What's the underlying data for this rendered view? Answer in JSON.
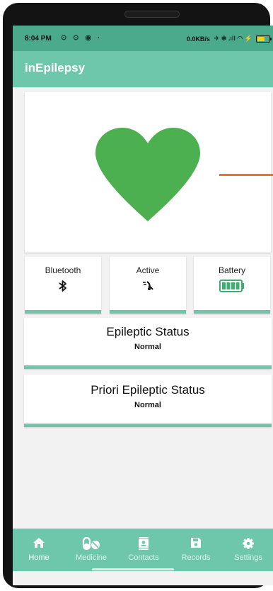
{
  "status_bar": {
    "time": "8:04 PM",
    "left_icons": "⊙ ⊙ ◉ ·",
    "net_speed": "0.0KB/s",
    "signal_icons": "✈ ✱ .ıll ◠ ⚡",
    "battery_level_fraction": 0.6,
    "battery_color": "#f2d21a"
  },
  "app_bar": {
    "title": "inEpilepsy",
    "color": "#6fc7ab"
  },
  "heart": {
    "icon": "heart-icon",
    "color": "#4caf50"
  },
  "sensors": [
    {
      "label": "Bluetooth",
      "icon": "bluetooth-icon",
      "glyph": "✱"
    },
    {
      "label": "Active",
      "icon": "sensor-activity-icon",
      "glyph": "≈"
    },
    {
      "label": "Battery",
      "icon": "battery-full-icon",
      "glyph": ""
    }
  ],
  "epileptic_status": {
    "title": "Epileptic Status",
    "value": "Normal"
  },
  "priori_status": {
    "title": "Priori Epileptic Status",
    "value": "Normal"
  },
  "nav": [
    {
      "label": "Home",
      "icon": "home-icon",
      "active": true
    },
    {
      "label": "Medicine",
      "icon": "medicine-icon",
      "active": false
    },
    {
      "label": "Contacts",
      "icon": "contacts-icon",
      "active": false
    },
    {
      "label": "Records",
      "icon": "records-icon",
      "active": false
    },
    {
      "label": "Settings",
      "icon": "settings-icon",
      "active": false
    }
  ],
  "colors": {
    "accent": "#6fc7ab",
    "heart": "#4caf50",
    "indicator_line": "#e8732c"
  }
}
